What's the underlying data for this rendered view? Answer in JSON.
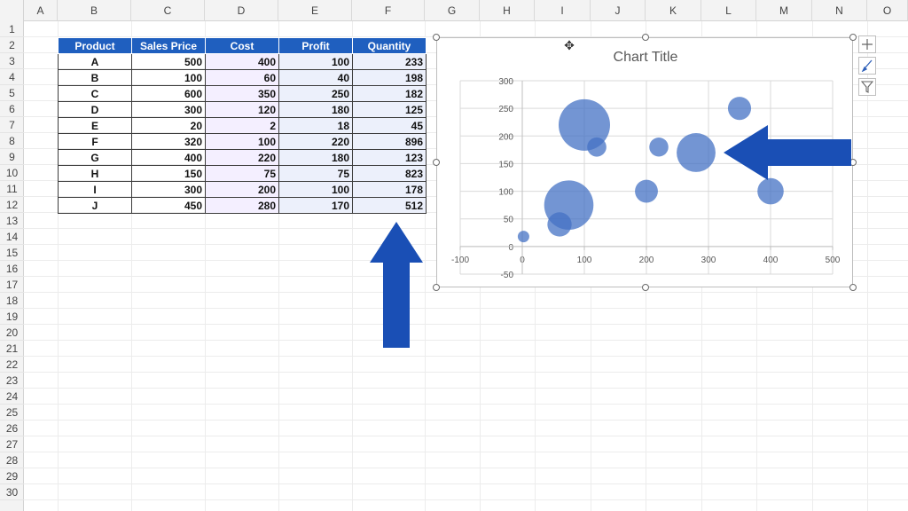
{
  "sheet": {
    "columns": [
      "A",
      "B",
      "C",
      "D",
      "E",
      "F",
      "G",
      "H",
      "I",
      "J",
      "K",
      "L",
      "M",
      "N",
      "O"
    ],
    "rows": [
      "1",
      "2",
      "3",
      "4",
      "5",
      "6",
      "7",
      "8",
      "9",
      "10",
      "11",
      "12",
      "13",
      "14",
      "15",
      "16",
      "17",
      "18",
      "19",
      "20",
      "21",
      "22",
      "23",
      "24",
      "25",
      "26",
      "27",
      "28",
      "29",
      "30"
    ]
  },
  "table": {
    "headers": [
      "Product",
      "Sales Price",
      "Cost",
      "Profit",
      "Quantity"
    ],
    "rows": [
      [
        "A",
        "500",
        "400",
        "100",
        "233"
      ],
      [
        "B",
        "100",
        "60",
        "40",
        "198"
      ],
      [
        "C",
        "600",
        "350",
        "250",
        "182"
      ],
      [
        "D",
        "300",
        "120",
        "180",
        "125"
      ],
      [
        "E",
        "20",
        "2",
        "18",
        "45"
      ],
      [
        "F",
        "320",
        "100",
        "220",
        "896"
      ],
      [
        "G",
        "400",
        "220",
        "180",
        "123"
      ],
      [
        "H",
        "150",
        "75",
        "75",
        "823"
      ],
      [
        "I",
        "300",
        "200",
        "100",
        "178"
      ],
      [
        "J",
        "450",
        "280",
        "170",
        "512"
      ]
    ]
  },
  "chart": {
    "title": "Chart Title",
    "side_buttons": [
      "plus-icon",
      "brush-icon",
      "filter-icon"
    ]
  },
  "colors": {
    "header_fill": "#1f5fbf",
    "bubble": "#4472c4",
    "arrow": "#1a4fb5"
  },
  "chart_data": {
    "type": "scatter",
    "subtype": "bubble",
    "title": "Chart Title",
    "xlim": [
      -100,
      500
    ],
    "ylim": [
      -50,
      300
    ],
    "x_ticks": [
      "-100",
      "0",
      "100",
      "200",
      "300",
      "400",
      "500"
    ],
    "y_ticks": [
      "-50",
      "0",
      "50",
      "100",
      "150",
      "200",
      "250",
      "300"
    ],
    "grid": true,
    "points": [
      {
        "x": 400,
        "y": 100,
        "size": 233
      },
      {
        "x": 60,
        "y": 40,
        "size": 198
      },
      {
        "x": 350,
        "y": 250,
        "size": 182
      },
      {
        "x": 120,
        "y": 180,
        "size": 125
      },
      {
        "x": 2,
        "y": 18,
        "size": 45
      },
      {
        "x": 100,
        "y": 220,
        "size": 896
      },
      {
        "x": 220,
        "y": 180,
        "size": 123
      },
      {
        "x": 75,
        "y": 75,
        "size": 823
      },
      {
        "x": 200,
        "y": 100,
        "size": 178
      },
      {
        "x": 280,
        "y": 170,
        "size": 512
      }
    ]
  }
}
